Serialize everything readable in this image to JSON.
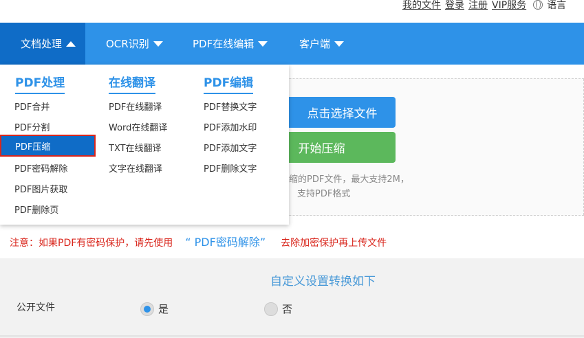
{
  "toplinks": {
    "my_files": "我的文件",
    "login": "登录",
    "register": "注册",
    "vip": "VIP服务",
    "language": "语言"
  },
  "nav": {
    "items": [
      {
        "label": "文档处理"
      },
      {
        "label": "OCR识别"
      },
      {
        "label": "PDF在线编辑"
      },
      {
        "label": "客户端"
      }
    ]
  },
  "dropdown": {
    "columns": [
      {
        "heading": "PDF处理",
        "links": [
          "PDF合并",
          "PDF分割",
          "PDF压缩",
          "PDF密码解除",
          "PDF图片获取",
          "PDF删除页"
        ]
      },
      {
        "heading": "在线翻译",
        "links": [
          "PDF在线翻译",
          "Word在线翻译",
          "TXT在线翻译",
          "文字在线翻译"
        ]
      },
      {
        "heading": "PDF编辑",
        "links": [
          "PDF替换文字",
          "PDF添加水印",
          "PDF添加文字",
          "PDF删除文字"
        ]
      }
    ]
  },
  "upload": {
    "select_button": "点击选择文件",
    "start_button": "开始压缩",
    "hint_line1": "缩的PDF文件，最大支持2M，",
    "hint_line2": "支持PDF格式"
  },
  "notice": {
    "prefix": "注意：如果PDF有密码保护，请先使用",
    "highlight": "“ PDF密码解除”",
    "suffix": "去除加密保护再上传文件"
  },
  "settings": {
    "title": "自定义设置转换如下",
    "public_label": "公开文件",
    "option_yes": "是",
    "option_no": "否"
  }
}
